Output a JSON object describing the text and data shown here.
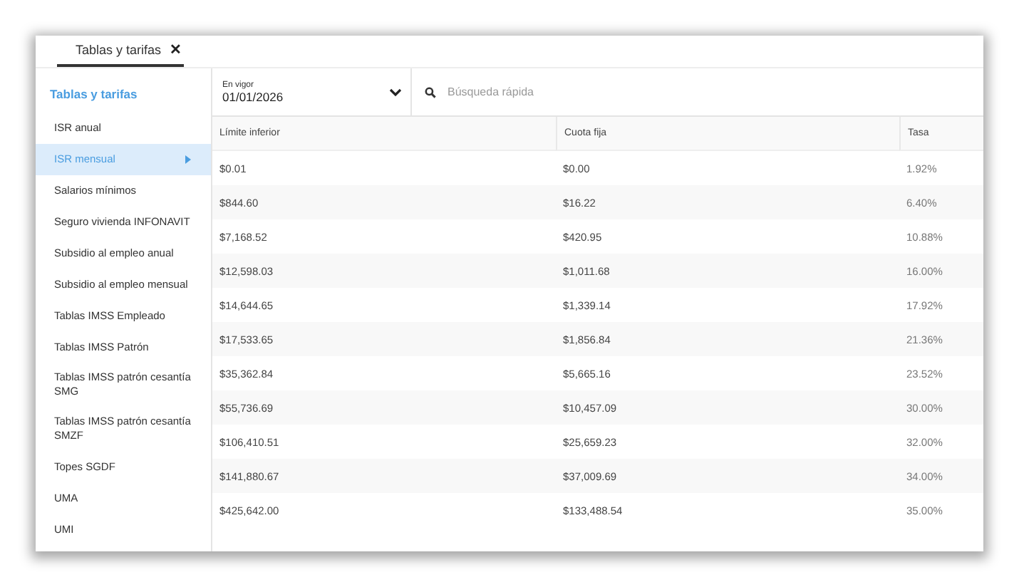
{
  "tabs": [
    {
      "label": "Tablas y tarifas",
      "close": "✕",
      "selected": true
    }
  ],
  "sidebar": {
    "title": "Tablas y tarifas",
    "items": [
      {
        "label": "ISR anual",
        "selected": false
      },
      {
        "label": "ISR mensual",
        "selected": true
      },
      {
        "label": "Salarios mínimos",
        "selected": false
      },
      {
        "label": "Seguro vivienda INFONAVIT",
        "selected": false
      },
      {
        "label": "Subsidio al empleo anual",
        "selected": false
      },
      {
        "label": "Subsidio al empleo mensual",
        "selected": false
      },
      {
        "label": "Tablas IMSS Empleado",
        "selected": false
      },
      {
        "label": "Tablas IMSS Patrón",
        "selected": false
      },
      {
        "label": "Tablas IMSS patrón cesantía SMG",
        "selected": false
      },
      {
        "label": "Tablas IMSS patrón cesantía SMZF",
        "selected": false
      },
      {
        "label": "Topes SGDF",
        "selected": false
      },
      {
        "label": "UMA",
        "selected": false
      },
      {
        "label": "UMI",
        "selected": false
      }
    ]
  },
  "filter": {
    "label": "En vigor",
    "value": "01/01/2026"
  },
  "search": {
    "placeholder": "Búsqueda rápida"
  },
  "table": {
    "columns": [
      "Límite inferior",
      "Cuota fija",
      "Tasa"
    ],
    "rows": [
      [
        "$0.01",
        "$0.00",
        "1.92%"
      ],
      [
        "$844.60",
        "$16.22",
        "6.40%"
      ],
      [
        "$7,168.52",
        "$420.95",
        "10.88%"
      ],
      [
        "$12,598.03",
        "$1,011.68",
        "16.00%"
      ],
      [
        "$14,644.65",
        "$1,339.14",
        "17.92%"
      ],
      [
        "$17,533.65",
        "$1,856.84",
        "21.36%"
      ],
      [
        "$35,362.84",
        "$5,665.16",
        "23.52%"
      ],
      [
        "$55,736.69",
        "$10,457.09",
        "30.00%"
      ],
      [
        "$106,410.51",
        "$25,659.23",
        "32.00%"
      ],
      [
        "$141,880.67",
        "$37,009.69",
        "34.00%"
      ],
      [
        "$425,642.00",
        "$133,488.54",
        "35.00%"
      ]
    ]
  }
}
